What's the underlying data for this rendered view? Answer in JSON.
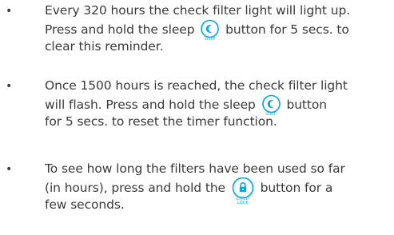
{
  "instructions": [
    {
      "bullet": "•",
      "line1": "Every 320 hours the check filter light will light up.",
      "line2_before": "Press and hold the sleep",
      "line2_after": "button for 5 secs. to",
      "line3": "clear this reminder.",
      "button": {
        "icon": "moon-icon",
        "caption": "SLEEP"
      }
    },
    {
      "bullet": "•",
      "line1": "Once 1500 hours is reached, the check filter light",
      "line2_before": "will flash.  Press and hold the sleep",
      "line2_after": "button",
      "line3": "for 5 secs. to reset the timer function.",
      "button": {
        "icon": "moon-icon",
        "caption": "SLEEP"
      }
    },
    {
      "bullet": "•",
      "line1": "To see how long the filters have been used so far",
      "line2_before": "(in hours), press and hold the",
      "line2_after": "button for a",
      "line3": "few seconds.",
      "button": {
        "icon": "lock-icon",
        "caption": "CHILD LOCK"
      }
    }
  ],
  "colors": {
    "text": "#3a3a3a",
    "icon_accent": "#00a7e1"
  }
}
